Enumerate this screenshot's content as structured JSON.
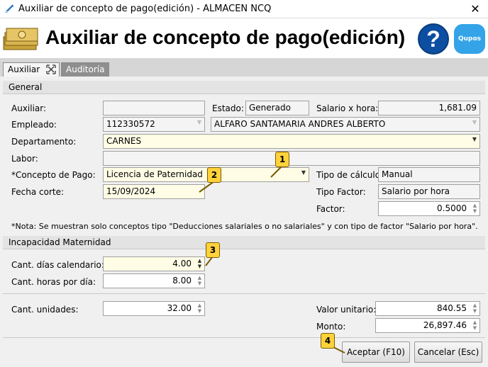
{
  "window": {
    "title": "Auxiliar de concepto de pago(edición) - ALMACEN NCQ",
    "close": "✕"
  },
  "header": {
    "title": "Auxiliar de concepto de pago(edición)",
    "help": "?",
    "brand": "Qupos"
  },
  "tabs": [
    {
      "label": "Auxiliar"
    },
    {
      "label": "Auditoría"
    }
  ],
  "general": {
    "section": "General",
    "auxiliar_label": "Auxiliar:",
    "auxiliar_value": "",
    "estado_label": "Estado:",
    "estado_value": "Generado",
    "salario_label": "Salario x hora:",
    "salario_value": "1,681.09",
    "empleado_label": "Empleado:",
    "empleado_code": "112330572",
    "empleado_name": "ALFARO  SANTAMARIA ANDRES ALBERTO",
    "departamento_label": "Departamento:",
    "departamento_value": "CARNES",
    "labor_label": "Labor:",
    "labor_value": "",
    "concepto_label": "*Concepto de Pago:",
    "concepto_value": "Licencia de Paternidad",
    "tipo_calculo_label": "Tipo de cálculo:",
    "tipo_calculo_value": "Manual",
    "fecha_label": "Fecha corte:",
    "fecha_value": "15/09/2024",
    "tipo_factor_label": "Tipo Factor:",
    "tipo_factor_value": "Salario por hora",
    "factor_label": "Factor:",
    "factor_value": "0.5000",
    "nota": "*Nota: Se muestran solo conceptos tipo \"Deducciones salariales o no salariales\" y con tipo de factor \"Salario por hora\"."
  },
  "incapacidad": {
    "section": "Incapacidad Maternidad",
    "dias_label": "Cant. días calendario:",
    "dias_value": "4.00",
    "horas_label": "Cant. horas por día:",
    "horas_value": "8.00"
  },
  "totales": {
    "unidades_label": "Cant. unidades:",
    "unidades_value": "32.00",
    "valor_label": "Valor unitario:",
    "valor_value": "840.55",
    "monto_label": "Monto:",
    "monto_value": "26,897.46"
  },
  "buttons": {
    "accept": "Aceptar (F10)",
    "cancel": "Cancelar (Esc)"
  },
  "callouts": [
    "1",
    "2",
    "3",
    "4"
  ]
}
